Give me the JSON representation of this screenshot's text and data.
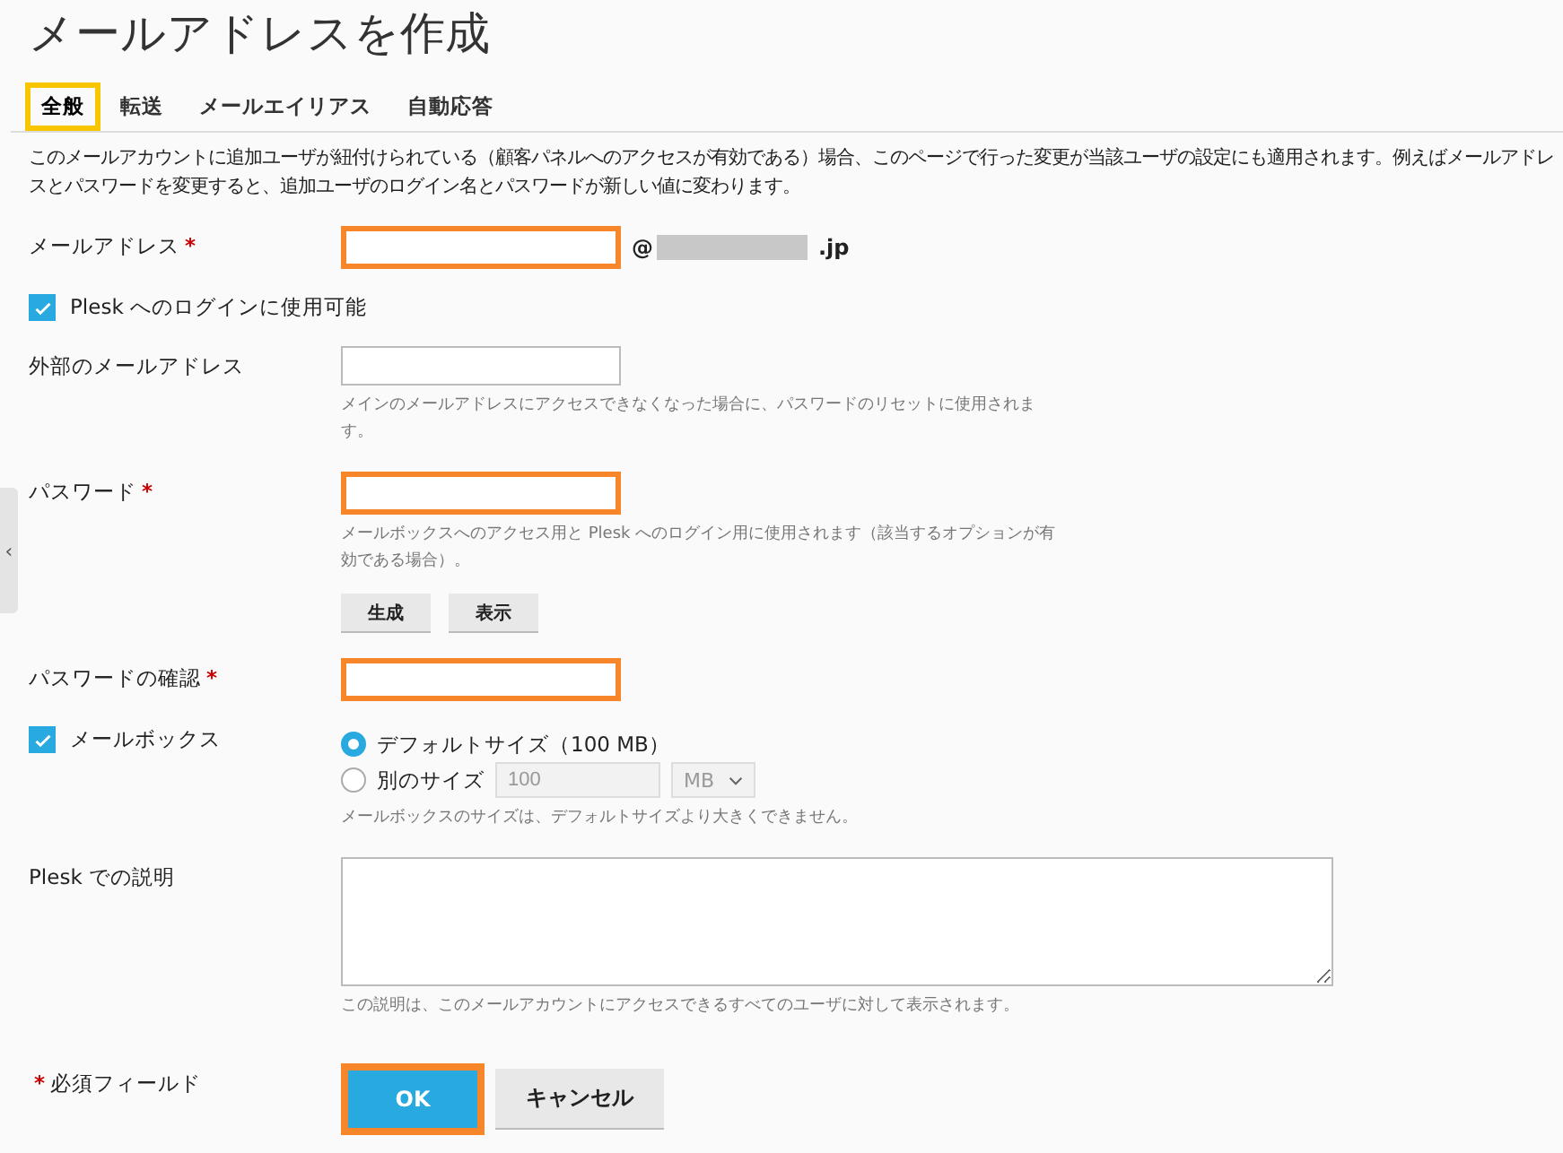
{
  "title": "メールアドレスを作成",
  "tabs": [
    {
      "label": "全般",
      "selected": true,
      "highlighted": true
    },
    {
      "label": "転送",
      "selected": false,
      "highlighted": false
    },
    {
      "label": "メールエイリアス",
      "selected": false,
      "highlighted": false
    },
    {
      "label": "自動応答",
      "selected": false,
      "highlighted": false
    }
  ],
  "description": "このメールアカウントに追加ユーザが紐付けられている（顧客パネルへのアクセスが有効である）場合、このページで行った変更が当該ユーザの設定にも適用されます。例えばメールアドレスとパスワードを変更すると、追加ユーザのログイン名とパスワードが新しい値に変わります。",
  "required_mark": "*",
  "sidebar_toggle": "‹",
  "fields": [
    {
      "kind": "email",
      "label": "メールアドレス",
      "required": true,
      "highlighted": true,
      "at": "@",
      "domain_suffix": ".jp"
    },
    {
      "kind": "checkbox",
      "label": "Plesk へのログインに使用可能",
      "checked": true
    },
    {
      "kind": "text",
      "label": "外部のメールアドレス",
      "required": false,
      "highlighted": false,
      "hint": "メインのメールアドレスにアクセスできなくなった場合に、パスワードのリセットに使用されます。"
    },
    {
      "kind": "password",
      "label": "パスワード",
      "required": true,
      "highlighted": true,
      "hint": "メールボックスへのアクセス用と Plesk へのログイン用に使用されます（該当するオプションが有効である場合）。",
      "buttons": [
        "生成",
        "表示"
      ]
    },
    {
      "kind": "text",
      "label": "パスワードの確認",
      "required": true,
      "highlighted": true
    },
    {
      "kind": "mailbox",
      "label": "メールボックス",
      "checked": true,
      "options": [
        {
          "label": "デフォルトサイズ（100 MB）",
          "selected": true
        },
        {
          "label": "別のサイズ",
          "selected": false,
          "value": "100",
          "unit": "MB"
        }
      ],
      "hint": "メールボックスのサイズは、デフォルトサイズより大きくできません。"
    },
    {
      "kind": "textarea",
      "label": "Plesk での説明",
      "required": false,
      "hint": "この説明は、このメールアカウントにアクセスできるすべてのユーザに対して表示されます。"
    }
  ],
  "footer": {
    "required_note": "必須フィールド",
    "buttons": [
      {
        "label": "OK",
        "kind": "primary",
        "highlighted": true
      },
      {
        "label": "キャンセル",
        "kind": "secondary",
        "highlighted": false
      }
    ]
  }
}
